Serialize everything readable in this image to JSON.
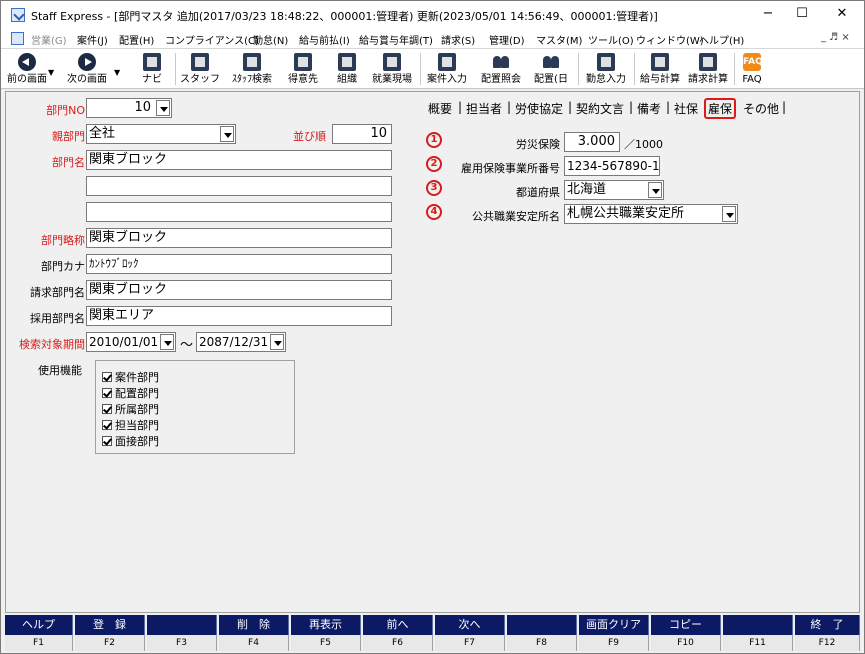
{
  "window": {
    "title": "Staff Express - [部門マスタ 追加(2017/03/23 18:48:22、000001:管理者) 更新(2023/05/01 14:56:49、000001:管理者)]",
    "minimize": "−",
    "maximize": "☐",
    "close": "✕"
  },
  "menubar": {
    "items": [
      {
        "label": "営業(G)",
        "disabled": true
      },
      {
        "label": "案件(J)",
        "disabled": false
      },
      {
        "label": "配置(H)",
        "disabled": false
      },
      {
        "label": "コンプライアンス(C)",
        "disabled": false
      },
      {
        "label": "勤怠(N)",
        "disabled": false
      },
      {
        "label": "給与前払(I)",
        "disabled": false
      },
      {
        "label": "給与賞与年調(T)",
        "disabled": false
      },
      {
        "label": "請求(S)",
        "disabled": false
      },
      {
        "label": "管理(D)",
        "disabled": false
      },
      {
        "label": "マスタ(M)",
        "disabled": false
      },
      {
        "label": "ツール(O)",
        "disabled": false
      },
      {
        "label": "ウィンドウ(W)",
        "disabled": false
      },
      {
        "label": "ヘルプ(H)",
        "disabled": false
      }
    ],
    "mdi_controls": "_ ♬ ×"
  },
  "toolbar": {
    "buttons": [
      {
        "label": "前の画面",
        "icon": "arrow-left-icon"
      },
      {
        "label": "次の画面",
        "icon": "arrow-right-icon"
      },
      {
        "label": "ナビ",
        "icon": "navi-icon"
      },
      {
        "label": "スタッフ",
        "icon": "staff-icon"
      },
      {
        "label": "ｽﾀｯﾌ検索",
        "icon": "staff-search-icon"
      },
      {
        "label": "得意先",
        "icon": "customer-icon"
      },
      {
        "label": "組織",
        "icon": "organization-icon"
      },
      {
        "label": "就業現場",
        "icon": "worksite-icon"
      },
      {
        "label": "案件入力",
        "icon": "case-input-icon"
      },
      {
        "label": "配置照会",
        "icon": "placement-inquiry-icon"
      },
      {
        "label": "配置(日",
        "icon": "placement-daily-icon"
      },
      {
        "label": "勤怠入力",
        "icon": "attendance-input-icon"
      },
      {
        "label": "給与計算",
        "icon": "payroll-icon"
      },
      {
        "label": "請求計算",
        "icon": "billing-icon"
      },
      {
        "label": "FAQ",
        "icon": "faq-icon"
      }
    ],
    "faq_icon_text": "FAQ"
  },
  "form": {
    "dept_no": {
      "label": "部門NO",
      "value": "10"
    },
    "parent_dept": {
      "label": "親部門",
      "value": "全社"
    },
    "sort_order": {
      "label": "並び順",
      "value": "10"
    },
    "dept_name": {
      "label": "部門名",
      "value": "関東ブロック",
      "line2": "",
      "line3": ""
    },
    "dept_abbr": {
      "label": "部門略称",
      "value": "関東ブロック"
    },
    "dept_kana": {
      "label": "部門カナ",
      "value": "ｶﾝﾄｳﾌﾞﾛｯｸ"
    },
    "billing_dept": {
      "label": "請求部門名",
      "value": "関東ブロック"
    },
    "hiring_dept": {
      "label": "採用部門名",
      "value": "関東エリア"
    },
    "search_period": {
      "label": "検索対象期間",
      "from": "2010/01/01",
      "tilde": "～",
      "to": "2087/12/31"
    },
    "functions": {
      "label": "使用機能",
      "items": [
        "案件部門",
        "配置部門",
        "所属部門",
        "担当部門",
        "面接部門"
      ]
    }
  },
  "tabs": [
    "概要",
    "担当者",
    "労使協定",
    "契約文言",
    "備考",
    "社保",
    "雇保",
    "その他"
  ],
  "tab_separator": "|",
  "active_tab": "雇保",
  "koyou": {
    "rows": [
      {
        "marker": "1",
        "label": "労災保険",
        "value": "3.000",
        "unit": "／1000"
      },
      {
        "marker": "2",
        "label": "雇用保険事業所番号",
        "value": "1234-567890-1"
      },
      {
        "marker": "3",
        "label": "都道府県",
        "value": "北海道"
      },
      {
        "marker": "4",
        "label": "公共職業安定所名",
        "value": "札幌公共職業安定所"
      }
    ]
  },
  "fkeys": [
    {
      "label": "ヘルプ",
      "key": "F1"
    },
    {
      "label": "登　録",
      "key": "F2"
    },
    {
      "label": "",
      "key": "F3"
    },
    {
      "label": "削　除",
      "key": "F4"
    },
    {
      "label": "再表示",
      "key": "F5"
    },
    {
      "label": "前へ",
      "key": "F6"
    },
    {
      "label": "次へ",
      "key": "F7"
    },
    {
      "label": "",
      "key": "F8"
    },
    {
      "label": "画面クリア",
      "key": "F9"
    },
    {
      "label": "コピー",
      "key": "F10"
    },
    {
      "label": "",
      "key": "F11"
    },
    {
      "label": "終　了",
      "key": "F12"
    }
  ],
  "colors": {
    "required_label": "#d81b1b",
    "fkey_bar": "#0c1a66",
    "active_tab_border": "#e01818"
  }
}
